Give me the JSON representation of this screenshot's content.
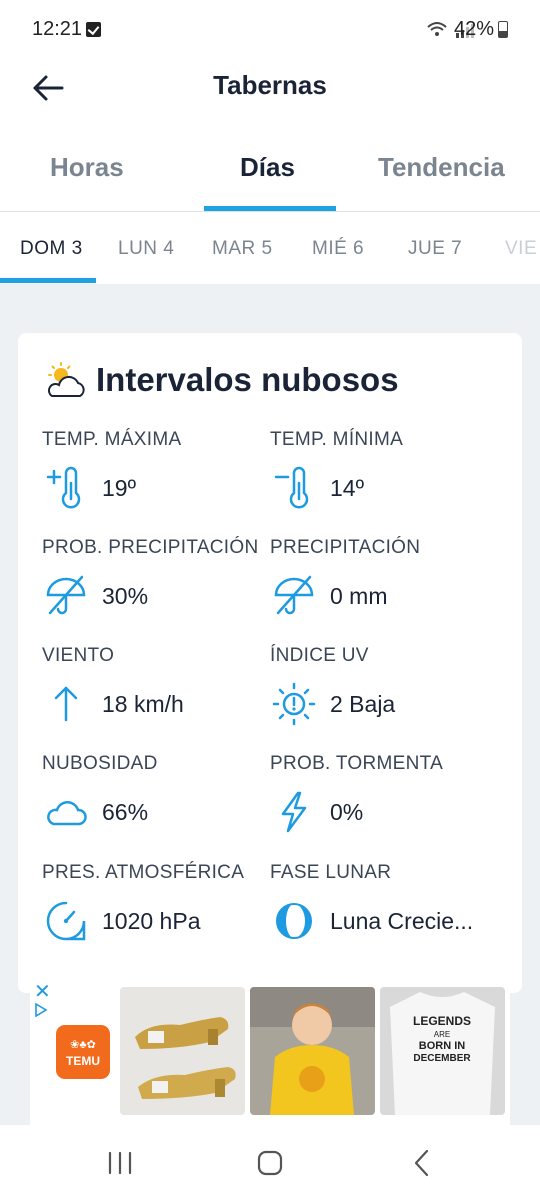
{
  "status_bar": {
    "time": "12:21",
    "battery": "42%"
  },
  "app_bar": {
    "title": "Tabernas"
  },
  "tabs": [
    {
      "label": "Horas"
    },
    {
      "label": "Días"
    },
    {
      "label": "Tendencia"
    }
  ],
  "days": [
    {
      "label": "DOM 3"
    },
    {
      "label": "LUN 4"
    },
    {
      "label": "MAR 5"
    },
    {
      "label": "MIÉ 6"
    },
    {
      "label": "JUE 7"
    },
    {
      "label": "VIE"
    }
  ],
  "forecast": {
    "summary": "Intervalos nubosos",
    "stats": [
      {
        "label": "TEMP. MÁXIMA",
        "value": "19º",
        "icon": "temp-max-icon"
      },
      {
        "label": "TEMP. MÍNIMA",
        "value": "14º",
        "icon": "temp-min-icon"
      },
      {
        "label": "PROB. PRECIPITACIÓN",
        "value": "30%",
        "icon": "umbrella-off-icon"
      },
      {
        "label": "PRECIPITACIÓN",
        "value": "0 mm",
        "icon": "umbrella-off-icon"
      },
      {
        "label": "VIENTO",
        "value": "18 km/h",
        "icon": "wind-arrow-icon"
      },
      {
        "label": "ÍNDICE UV",
        "value": "2 Baja",
        "icon": "uv-sun-icon"
      },
      {
        "label": "NUBOSIDAD",
        "value": "66%",
        "icon": "cloud-icon"
      },
      {
        "label": "PROB. TORMENTA",
        "value": "0%",
        "icon": "lightning-icon"
      },
      {
        "label": "PRES. ATMOSFÉRICA",
        "value": "1020 hPa",
        "icon": "gauge-icon"
      },
      {
        "label": "FASE LUNAR",
        "value": "Luna Crecie...",
        "icon": "moon-icon"
      }
    ]
  },
  "ad": {
    "brand": "TEMU",
    "tshirt_text": [
      "LEGENDS",
      "ARE",
      "BORN IN",
      "DECEMBER"
    ]
  },
  "colors": {
    "accent": "#1ea3e0",
    "title": "#1a2436",
    "muted": "#7b8590",
    "background": "#eef1f4"
  }
}
